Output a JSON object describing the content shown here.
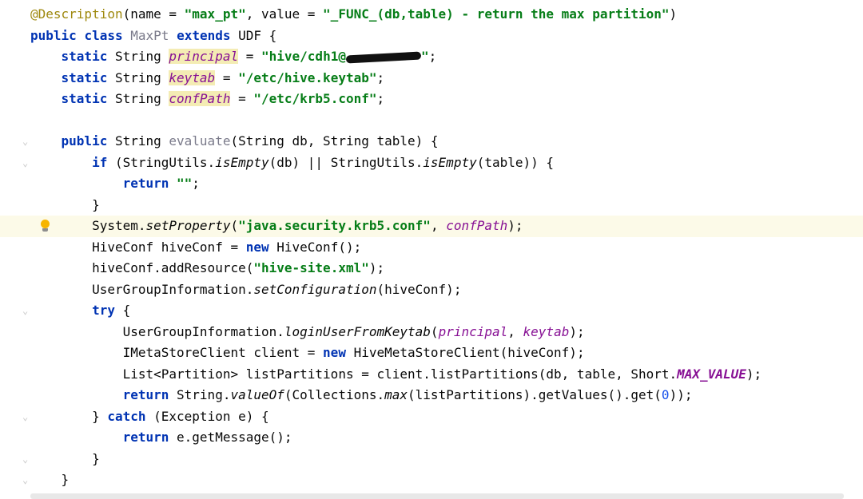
{
  "code": {
    "l1_ann": "@Description",
    "l1_a": "(name = ",
    "l1_s1": "\"max_pt\"",
    "l1_b": ", value = ",
    "l1_s2": "\"_FUNC_(db,table) - return the max partition\"",
    "l1_c": ")",
    "l2_public": "public",
    "l2_class": "class",
    "l2_name": "MaxPt",
    "l2_extends": "extends",
    "l2_rest": " UDF {",
    "l3_static": "static",
    "l3_type": " String ",
    "l3_field": "principal",
    "l3_eq": " = ",
    "l3_str": "\"hive/cdh1@",
    "l3_str_end": "\"",
    "l3_end": ";",
    "l4_static": "static",
    "l4_type": " String ",
    "l4_field": "keytab",
    "l4_eq": " = ",
    "l4_str": "\"/etc/hive.keytab\"",
    "l4_end": ";",
    "l5_static": "static",
    "l5_type": " String ",
    "l5_field": "confPath",
    "l5_eq": " = ",
    "l5_str": "\"/etc/krb5.conf\"",
    "l5_end": ";",
    "l7_public": "public",
    "l7_a": " String ",
    "l7_method": "evaluate",
    "l7_b": "(String db, String table) {",
    "l8_if": "if",
    "l8_a": " (StringUtils.",
    "l8_m1": "isEmpty",
    "l8_b": "(db) || StringUtils.",
    "l8_m2": "isEmpty",
    "l8_c": "(table)) {",
    "l9_return": "return",
    "l9_str": "\"\"",
    "l9_end": ";",
    "l10": "}",
    "l11_a": "System.",
    "l11_m": "setProperty",
    "l11_b": "(",
    "l11_str": "\"java.security.krb5.conf\"",
    "l11_c": ", ",
    "l11_field": "confPath",
    "l11_d": ");",
    "l12_a": "HiveConf hiveConf = ",
    "l12_new": "new",
    "l12_b": " HiveConf();",
    "l13_a": "hiveConf.addResource(",
    "l13_str": "\"hive-site.xml\"",
    "l13_b": ");",
    "l14_a": "UserGroupInformation.",
    "l14_m": "setConfiguration",
    "l14_b": "(hiveConf);",
    "l15_try": "try",
    "l15_b": " {",
    "l16_a": "UserGroupInformation.",
    "l16_m": "loginUserFromKeytab",
    "l16_b": "(",
    "l16_f1": "principal",
    "l16_c": ", ",
    "l16_f2": "keytab",
    "l16_d": ");",
    "l17_a": "IMetaStoreClient client = ",
    "l17_new": "new",
    "l17_b": " HiveMetaStoreClient(hiveConf);",
    "l18_a": "List<Partition> listPartitions = client.listPartitions(db, table, Short.",
    "l18_const": "MAX_VALUE",
    "l18_b": ");",
    "l19_return": "return",
    "l19_a": " String.",
    "l19_m1": "valueOf",
    "l19_b": "(Collections.",
    "l19_m2": "max",
    "l19_c": "(listPartitions).getValues().get(",
    "l19_num": "0",
    "l19_d": "));",
    "l20_a": "} ",
    "l20_catch": "catch",
    "l20_b": " (Exception e) {",
    "l21_return": "return",
    "l21_a": " e.getMessage();",
    "l22": "}",
    "l23": "}"
  },
  "colors": {
    "keyword": "#0033b3",
    "string": "#067d17",
    "annotation": "#9e880d",
    "field": "#871094",
    "current_line": "#fcfae8"
  },
  "icons": {
    "intention": "lightbulb-icon",
    "fold": "fold-marker-icon"
  }
}
